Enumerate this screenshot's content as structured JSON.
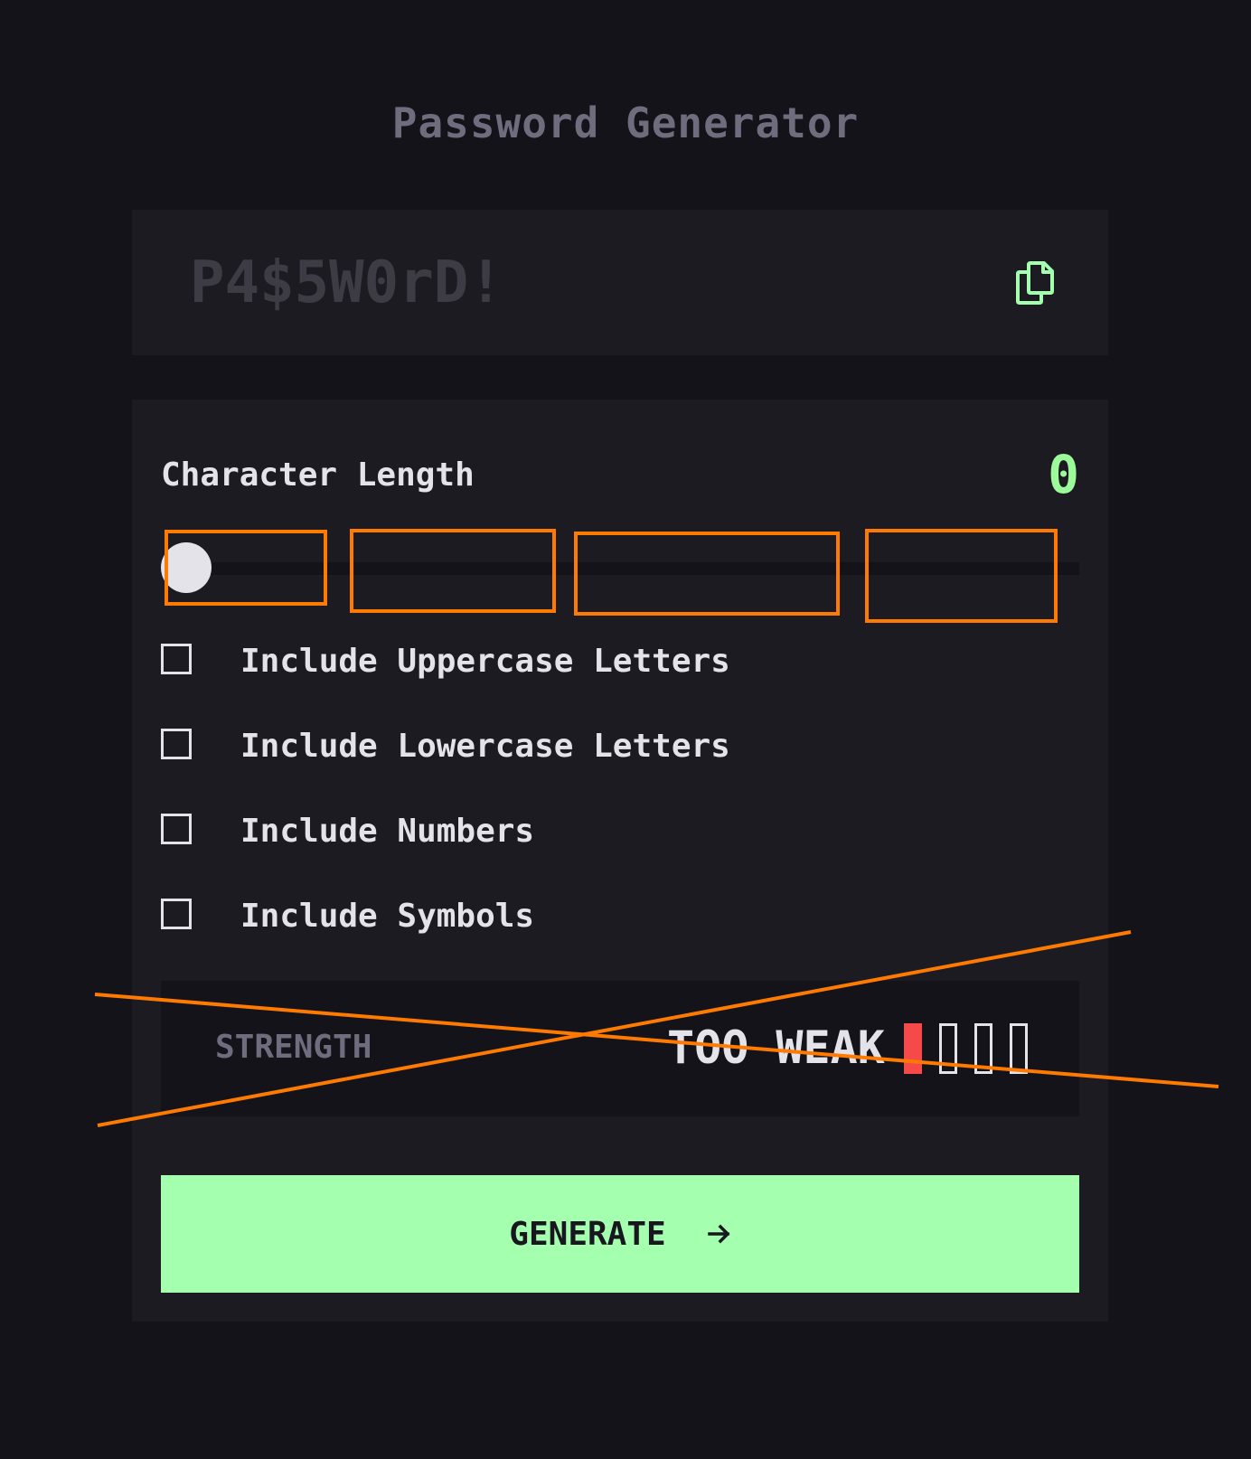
{
  "title": "Password Generator",
  "output": {
    "placeholder": "P4$5W0rD!"
  },
  "icons": {
    "copy": "copy-icon",
    "arrow": "arrow-right-icon"
  },
  "length": {
    "label": "Character Length",
    "value": "0"
  },
  "options": [
    {
      "label": "Include Uppercase Letters",
      "checked": false
    },
    {
      "label": "Include Lowercase Letters",
      "checked": false
    },
    {
      "label": "Include Numbers",
      "checked": false
    },
    {
      "label": "Include Symbols",
      "checked": false
    }
  ],
  "strength": {
    "label": "STRENGTH",
    "value": "TOO WEAK",
    "level": 1,
    "max_level": 4
  },
  "generate": {
    "label": "GENERATE"
  },
  "colors": {
    "background": "#131319",
    "panel": "#1c1b22",
    "accent": "#a4ffaf",
    "text": "#e4e3ea",
    "muted": "#6f6c7d",
    "weak": "#f64a4a",
    "annotation": "#ff7a00"
  }
}
